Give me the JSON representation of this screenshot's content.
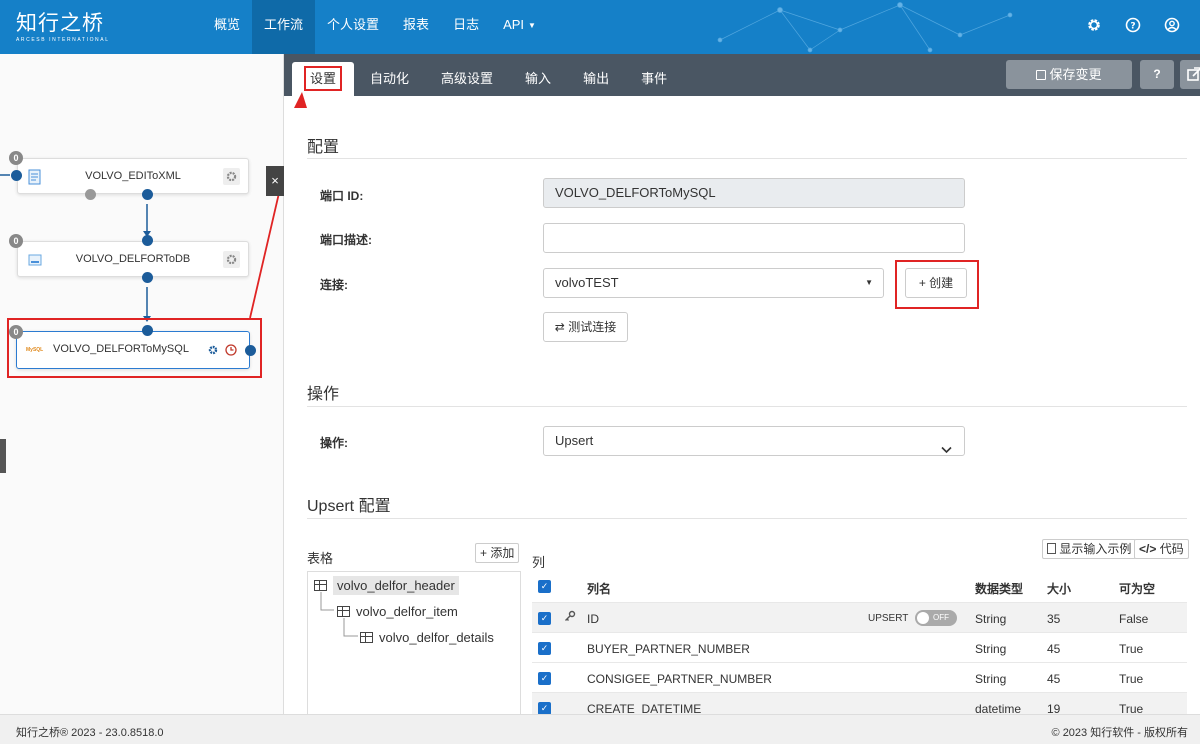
{
  "logo": {
    "cn": "知行之桥",
    "en": "ARCESB INTERNATIONAL"
  },
  "nav": {
    "items": [
      "概览",
      "工作流",
      "个人设置",
      "报表",
      "日志",
      "API"
    ],
    "active": "工作流"
  },
  "flow": {
    "nodes": [
      {
        "label": "VOLVO_EDIToXML",
        "badge": "0"
      },
      {
        "label": "VOLVO_DELFORToDB",
        "badge": "0"
      },
      {
        "label": "VOLVO_DELFORToMySQL",
        "badge": "0",
        "icon_text": "MySQL"
      }
    ],
    "close": "×"
  },
  "tabs": [
    "设置",
    "自动化",
    "高级设置",
    "输入",
    "输出",
    "事件"
  ],
  "toolbar": {
    "save": "保存变更",
    "help": "?"
  },
  "config": {
    "title": "配置",
    "port_id_label": "端口 ID:",
    "port_id_value": "VOLVO_DELFORToMySQL",
    "desc_label": "端口描述:",
    "desc_value": "",
    "conn_label": "连接:",
    "conn_value": "volvoTEST",
    "create_btn": "+ 创建",
    "test_btn": "测试连接"
  },
  "operation": {
    "title": "操作",
    "label": "操作:",
    "value": "Upsert"
  },
  "upsert": {
    "title": "Upsert 配置",
    "tables_label": "表格",
    "add_btn": "+ 添加",
    "columns_label": "列",
    "show_sample_btn": "显示输入示例",
    "code_btn": "代码",
    "tables": [
      "volvo_delfor_header",
      "volvo_delfor_item",
      "volvo_delfor_details"
    ],
    "col_headers": {
      "name": "列名",
      "type": "数据类型",
      "size": "大小",
      "nullable": "可为空"
    },
    "rows": [
      {
        "name": "ID",
        "type": "String",
        "size": "35",
        "nullable": "False",
        "upsert": "UPSERT",
        "toggle": "OFF"
      },
      {
        "name": "BUYER_PARTNER_NUMBER",
        "type": "String",
        "size": "45",
        "nullable": "True"
      },
      {
        "name": "CONSIGEE_PARTNER_NUMBER",
        "type": "String",
        "size": "45",
        "nullable": "True"
      },
      {
        "name": "CREATE_DATETIME",
        "type": "datetime",
        "size": "19",
        "nullable": "True"
      }
    ]
  },
  "footer": {
    "left": "知行之桥® 2023 - 23.0.8518.0",
    "right": "© 2023 知行软件 - 版权所有"
  }
}
